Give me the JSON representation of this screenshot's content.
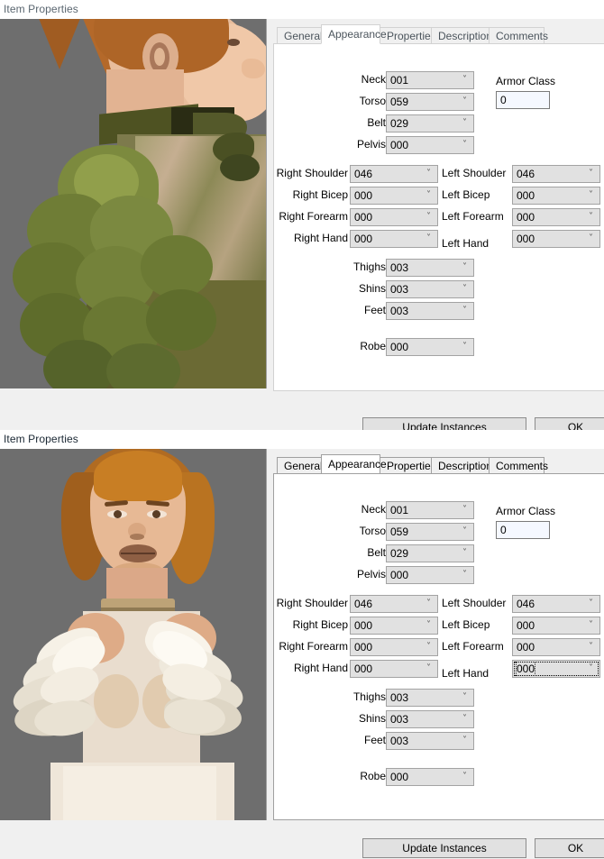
{
  "windows": [
    {
      "title": "Item Properties",
      "active": false,
      "tabs": [
        {
          "label": "General",
          "selected": false
        },
        {
          "label": "Appearance",
          "selected": true
        },
        {
          "label": "Properties",
          "selected": false
        },
        {
          "label": "Description",
          "selected": false
        },
        {
          "label": "Comments",
          "selected": false
        }
      ],
      "center_fields": [
        {
          "label": "Neck",
          "value": "001"
        },
        {
          "label": "Torso",
          "value": "059"
        },
        {
          "label": "Belt",
          "value": "029"
        },
        {
          "label": "Pelvis",
          "value": "000"
        }
      ],
      "left_fields": [
        {
          "label": "Right Shoulder",
          "value": "046"
        },
        {
          "label": "Right Bicep",
          "value": "000"
        },
        {
          "label": "Right Forearm",
          "value": "000"
        },
        {
          "label": "Right Hand",
          "value": "000"
        }
      ],
      "right_fields": [
        {
          "label": "Left Shoulder",
          "value": "046",
          "focused": false
        },
        {
          "label": "Left Bicep",
          "value": "000",
          "focused": false
        },
        {
          "label": "Left Forearm",
          "value": "000",
          "focused": false
        },
        {
          "label": "Left Hand",
          "value": "000",
          "focused": false
        }
      ],
      "leg_fields": [
        {
          "label": "Thighs",
          "value": "003"
        },
        {
          "label": "Shins",
          "value": "003"
        },
        {
          "label": "Feet",
          "value": "003"
        }
      ],
      "robe_field": {
        "label": "Robe",
        "value": "000"
      },
      "armor_class": {
        "label": "Armor Class",
        "value": "0"
      },
      "buttons": {
        "update": "Update Instances",
        "ok": "OK"
      },
      "preview": {
        "description": "3D character bust, side view, green leaf shoulder armor",
        "background": "#6e6e6e"
      }
    },
    {
      "title": "Item Properties",
      "active": true,
      "tabs": [
        {
          "label": "General",
          "selected": false
        },
        {
          "label": "Appearance",
          "selected": true
        },
        {
          "label": "Properties",
          "selected": false
        },
        {
          "label": "Description",
          "selected": false
        },
        {
          "label": "Comments",
          "selected": false
        }
      ],
      "center_fields": [
        {
          "label": "Neck",
          "value": "001"
        },
        {
          "label": "Torso",
          "value": "059"
        },
        {
          "label": "Belt",
          "value": "029"
        },
        {
          "label": "Pelvis",
          "value": "000"
        }
      ],
      "left_fields": [
        {
          "label": "Right Shoulder",
          "value": "046"
        },
        {
          "label": "Right Bicep",
          "value": "000"
        },
        {
          "label": "Right Forearm",
          "value": "000"
        },
        {
          "label": "Right Hand",
          "value": "000"
        }
      ],
      "right_fields": [
        {
          "label": "Left Shoulder",
          "value": "046",
          "focused": false
        },
        {
          "label": "Left Bicep",
          "value": "000",
          "focused": false
        },
        {
          "label": "Left Forearm",
          "value": "000",
          "focused": false
        },
        {
          "label": "Left Hand",
          "value": "000",
          "focused": true
        }
      ],
      "leg_fields": [
        {
          "label": "Thighs",
          "value": "003"
        },
        {
          "label": "Shins",
          "value": "003"
        },
        {
          "label": "Feet",
          "value": "003"
        }
      ],
      "robe_field": {
        "label": "Robe",
        "value": "000"
      },
      "armor_class": {
        "label": "Armor Class",
        "value": "0"
      },
      "buttons": {
        "update": "Update Instances",
        "ok": "OK"
      },
      "preview": {
        "description": "3D character bust, front view, white feather shoulder armor",
        "background": "#6e6e6e"
      }
    }
  ],
  "icons": {
    "dropdown_arrow": "chevron-down-icon"
  },
  "colors": {
    "window_bg": "#f0f0f0",
    "panel_bg": "#ffffff",
    "control_bg": "#e1e1e1",
    "control_border": "#a3a3a3",
    "textbox_bg": "#f5f8ff",
    "viewport_bg": "#6e6e6e",
    "title_inactive": "#5a6670",
    "title_active": "#1a2733"
  }
}
